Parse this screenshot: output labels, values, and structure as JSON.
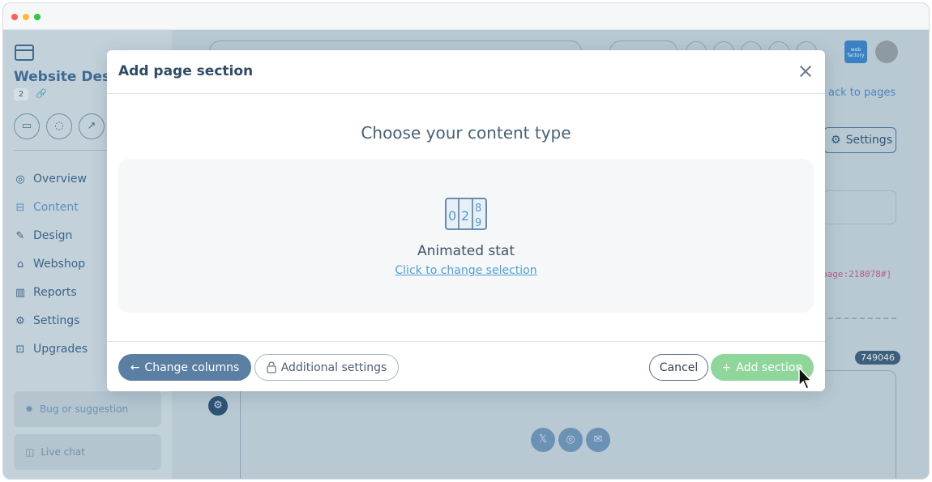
{
  "sidebar": {
    "site_title": "Website Desig",
    "site_badge": "2",
    "nav_items": [
      {
        "label": "Overview",
        "icon": "compass-icon"
      },
      {
        "label": "Content",
        "icon": "content-tree-icon"
      },
      {
        "label": "Design",
        "icon": "design-tools-icon"
      },
      {
        "label": "Webshop",
        "icon": "basket-icon"
      },
      {
        "label": "Reports",
        "icon": "chart-icon"
      },
      {
        "label": "Settings",
        "icon": "gear-icon"
      },
      {
        "label": "Upgrades",
        "icon": "upgrade-icon"
      }
    ],
    "bug_label": "Bug or suggestion",
    "chat_label": "Live chat"
  },
  "main": {
    "back_link": "ack to pages",
    "settings_label": "Settings",
    "code_snippet": "page:218078#]",
    "section_id": "749046",
    "logo_text": "web factory"
  },
  "modal": {
    "title": "Add page section",
    "heading": "Choose your content type",
    "card": {
      "label": "Animated stat",
      "link": "Click to change selection",
      "icon": "animated-stat-icon"
    },
    "footer": {
      "change_columns": "Change columns",
      "additional_settings": "Additional settings",
      "cancel": "Cancel",
      "add_section": "Add section"
    }
  },
  "colors": {
    "primary": "#5b7fa3",
    "success": "#8fd69a",
    "link": "#4f9fd8",
    "overlay": "#b9c9d3"
  }
}
